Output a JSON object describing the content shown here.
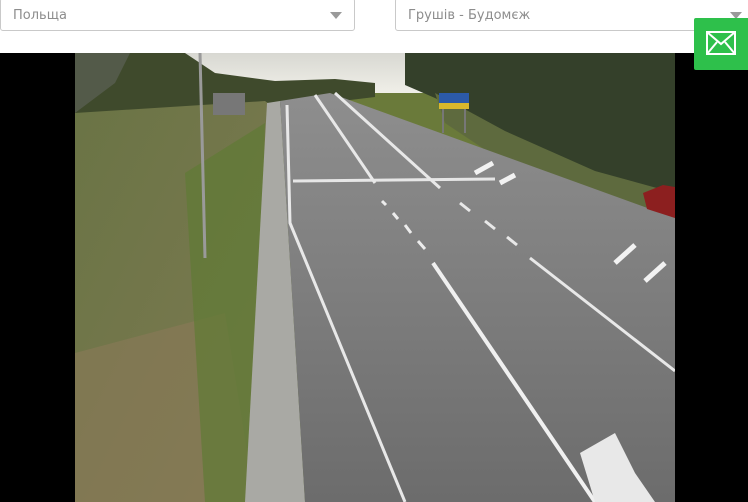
{
  "filters": {
    "country": {
      "value": "Польща"
    },
    "crossing": {
      "value": "Грушів - Будомєж"
    }
  },
  "actions": {
    "mail_icon": "envelope-icon",
    "mail_button_color": "#2ec04b"
  },
  "camera": {
    "background_color": "#000000"
  }
}
